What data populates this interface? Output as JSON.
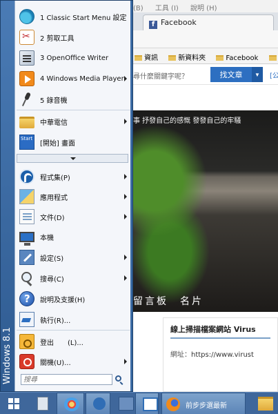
{
  "browser": {
    "menu_items": [
      "(B)",
      "工具 (I)",
      "說明 (H)"
    ],
    "active_tab": "Facebook",
    "bookmarks": [
      "資訊",
      "新資料夾",
      "Facebook",
      "討論"
    ],
    "search_prompt": "尋什麼關鍵字呢？",
    "search_button": "找文章",
    "search_extra": "[公",
    "photo_caption": "事 抒發自己的感慨 發發自己的牢騷",
    "photo_nav": "留言板　名片",
    "article_title": "線上掃描檔案網站 Virus",
    "article_url_label": "網址：",
    "article_url": "https://www.virust"
  },
  "start_menu": {
    "brand": "Windows 8.1",
    "pinned": [
      {
        "label": "1 Classic Start Menu 設定",
        "icon": "classic-shell-icon"
      },
      {
        "label": "2 剪取工具",
        "icon": "snipping-tool-icon"
      },
      {
        "label": "3 OpenOffice Writer",
        "icon": "openoffice-writer-icon"
      },
      {
        "label": "4 Windows Media Player",
        "icon": "media-player-icon"
      },
      {
        "label": "5 錄音機",
        "icon": "microphone-icon"
      }
    ],
    "recent": [
      {
        "label": "中華電信",
        "icon": "folder-icon"
      },
      {
        "label": "[開始] 畫面",
        "icon": "start-screen-icon"
      }
    ],
    "system": [
      {
        "label": "程式集(P)",
        "icon": "programs-icon"
      },
      {
        "label": "應用程式",
        "icon": "apps-icon"
      },
      {
        "label": "文件(D)",
        "icon": "documents-icon"
      },
      {
        "label": "本機",
        "icon": "this-pc-icon"
      },
      {
        "label": "設定(S)",
        "icon": "settings-icon"
      },
      {
        "label": "搜尋(C)",
        "icon": "search-icon"
      },
      {
        "label": "說明及支援(H)",
        "icon": "help-icon"
      },
      {
        "label": "執行(R)...",
        "icon": "run-icon"
      }
    ],
    "power": [
      {
        "label": "登出　　(L)...",
        "icon": "logoff-icon"
      },
      {
        "label": "關機(U)...",
        "icon": "shutdown-icon"
      }
    ],
    "search_placeholder": "搜尋"
  },
  "taskbar": {
    "firefox_label": "前步步選最新"
  }
}
